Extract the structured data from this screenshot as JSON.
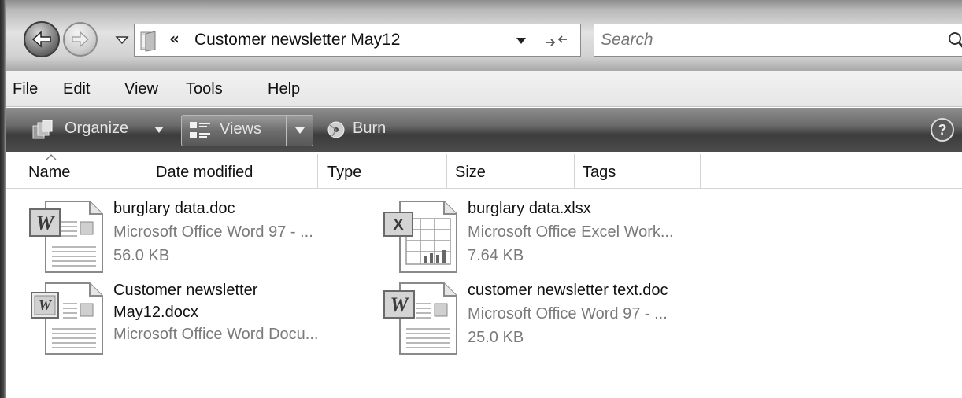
{
  "navigation": {
    "back_icon": "back-arrow-icon",
    "forward_icon": "forward-arrow-icon",
    "recent_pages_icon": "chevron-down-icon"
  },
  "address": {
    "overflow_chevron": "«",
    "path": "Customer newsletter May12",
    "refresh_glyph": "↛"
  },
  "search": {
    "placeholder": "Search"
  },
  "menu": {
    "items": [
      "File",
      "Edit",
      "View",
      "Tools",
      "Help"
    ]
  },
  "commands": {
    "organize_label": "Organize",
    "views_label": "Views",
    "burn_label": "Burn",
    "help_glyph": "?"
  },
  "columns": [
    "Name",
    "Date modified",
    "Type",
    "Size",
    "Tags"
  ],
  "files": [
    {
      "name": "burglary data.doc",
      "type": "Microsoft Office Word 97 - ...",
      "size": "56.0 KB",
      "icon": "word-97-doc-icon"
    },
    {
      "name": "burglary data.xlsx",
      "type": "Microsoft Office Excel Work...",
      "size": "7.64 KB",
      "icon": "excel-workbook-icon"
    },
    {
      "name_line1": "Customer newsletter",
      "name_line2": "May12.docx",
      "type": "Microsoft Office Word Docu...",
      "icon": "word-docx-icon"
    },
    {
      "name": "customer newsletter text.doc",
      "type": "Microsoft Office Word 97 - ...",
      "size": "25.0 KB",
      "icon": "word-97-doc-icon"
    }
  ]
}
